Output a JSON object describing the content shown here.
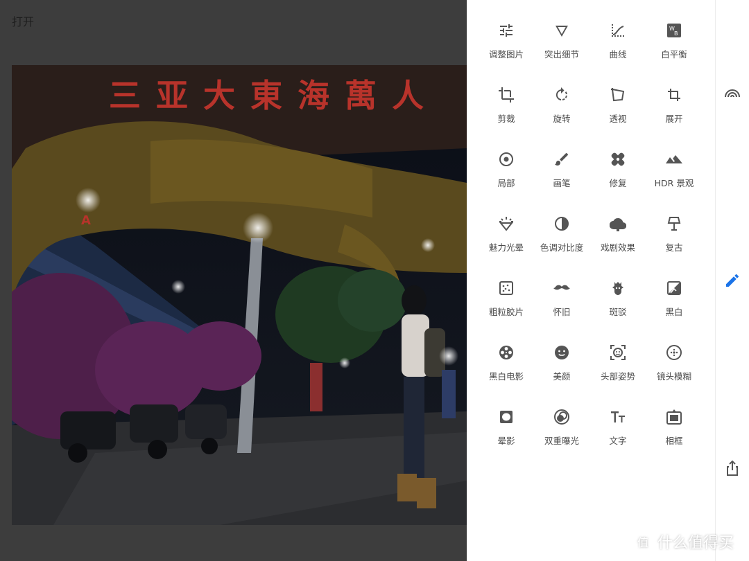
{
  "header": {
    "open_label": "打开"
  },
  "photo": {
    "sign_text": "三亚大東海萬人",
    "shop_sign": "A"
  },
  "tools": [
    {
      "label": "调整图片",
      "icon": "tune-sliders-icon"
    },
    {
      "label": "突出细节",
      "icon": "triangle-details-icon"
    },
    {
      "label": "曲线",
      "icon": "curves-icon"
    },
    {
      "label": "白平衡",
      "icon": "white-balance-icon"
    },
    {
      "label": "剪裁",
      "icon": "crop-icon"
    },
    {
      "label": "旋转",
      "icon": "rotate-icon"
    },
    {
      "label": "透视",
      "icon": "perspective-icon"
    },
    {
      "label": "展开",
      "icon": "expand-icon"
    },
    {
      "label": "局部",
      "icon": "selective-icon"
    },
    {
      "label": "画笔",
      "icon": "brush-icon"
    },
    {
      "label": "修复",
      "icon": "healing-bandage-icon"
    },
    {
      "label": "HDR 景观",
      "icon": "hdr-mountain-icon"
    },
    {
      "label": "魅力光晕",
      "icon": "glamour-glow-icon"
    },
    {
      "label": "色调对比度",
      "icon": "tonal-contrast-icon"
    },
    {
      "label": "戏剧效果",
      "icon": "drama-cloud-icon"
    },
    {
      "label": "复古",
      "icon": "vintage-lamp-icon"
    },
    {
      "label": "粗粒胶片",
      "icon": "grainy-film-icon"
    },
    {
      "label": "怀旧",
      "icon": "retrolux-mustache-icon"
    },
    {
      "label": "斑驳",
      "icon": "grunge-icon"
    },
    {
      "label": "黑白",
      "icon": "black-white-icon"
    },
    {
      "label": "黑白电影",
      "icon": "film-reel-icon"
    },
    {
      "label": "美颜",
      "icon": "face-glamour-icon"
    },
    {
      "label": "头部姿势",
      "icon": "head-pose-icon"
    },
    {
      "label": "镜头模糊",
      "icon": "lens-blur-icon"
    },
    {
      "label": "晕影",
      "icon": "vignette-icon"
    },
    {
      "label": "双重曝光",
      "icon": "double-exposure-icon"
    },
    {
      "label": "文字",
      "icon": "text-icon"
    },
    {
      "label": "相框",
      "icon": "frame-icon"
    }
  ],
  "rail": [
    {
      "name": "looks-icon"
    },
    {
      "name": "edit-pencil-icon",
      "color": "#1a73e8"
    },
    {
      "name": "share-icon"
    }
  ],
  "watermark": {
    "badge": "值",
    "text": "什么值得买"
  }
}
